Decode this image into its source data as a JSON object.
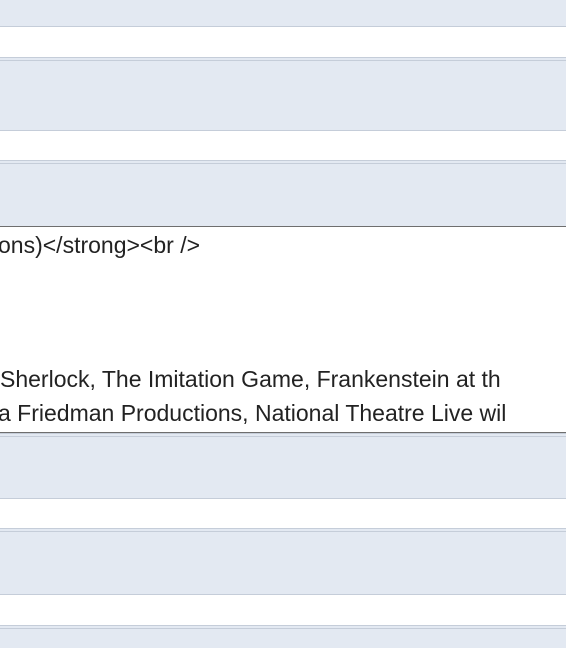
{
  "content": {
    "code_line": "ons)</strong><br />",
    "line1": " Sherlock, The Imitation Game, Frankenstein at th",
    "line2": "a Friedman Productions, National Theatre Live wil"
  },
  "colors": {
    "row_band": "#e3e9f2",
    "row_border": "#c5cdd9",
    "text": "#222222",
    "divider": "#6e6e6e"
  }
}
